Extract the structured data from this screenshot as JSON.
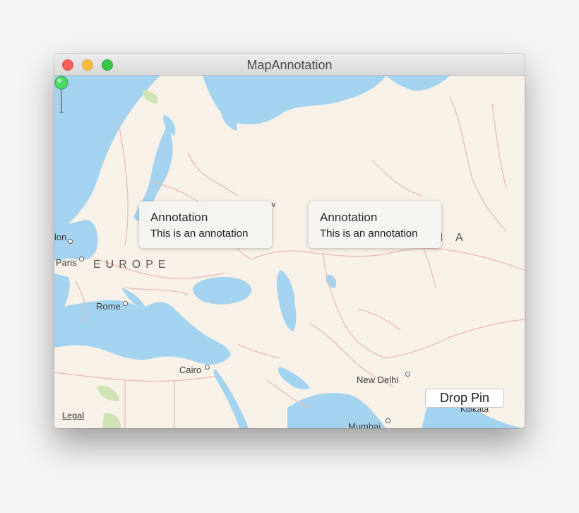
{
  "window": {
    "title": "MapAnnotation"
  },
  "map": {
    "labels": {
      "london_partial": "lon",
      "paris": "Paris",
      "europe": "EUROPE",
      "rome": "Rome",
      "cairo": "Cairo",
      "new_delhi": "New Delhi",
      "kolkata": "Kolkata",
      "mumbai": "Mumbai",
      "moscow_partial": "w",
      "asia_partial": "I A"
    },
    "legal": "Legal"
  },
  "annotations": [
    {
      "title": "Annotation",
      "subtitle": "This is an annotation"
    },
    {
      "title": "Annotation",
      "subtitle": "This is an annotation"
    }
  ],
  "pin": {
    "color": "#4cd964"
  },
  "toolbar": {
    "drop_pin_label": "Drop Pin"
  },
  "colors": {
    "water": "#a4d3f0",
    "land": "#f7f1e8",
    "border": "#e9b8b0",
    "park": "#cfe3b4"
  }
}
